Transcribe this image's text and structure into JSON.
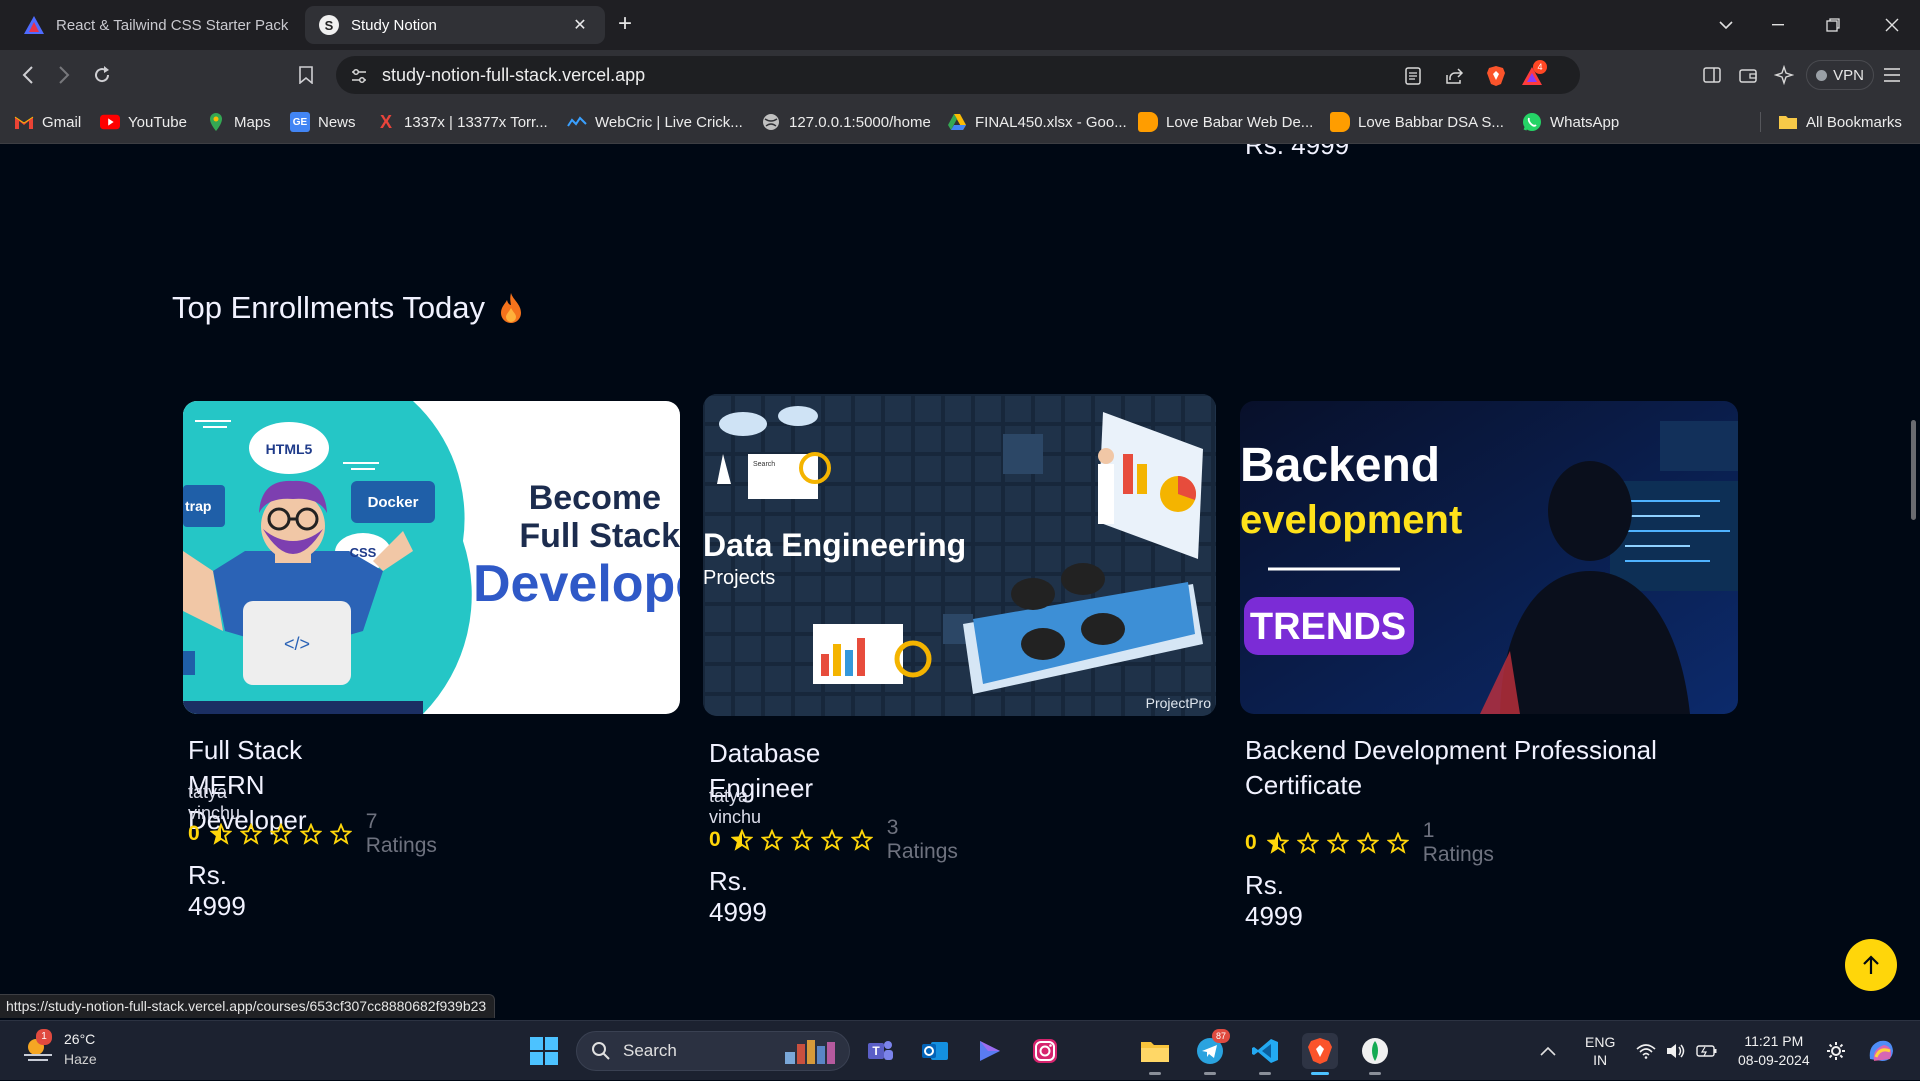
{
  "tabs": [
    {
      "title": "React & Tailwind CSS Starter Pack",
      "icon": "tailwind-triangle-icon"
    },
    {
      "title": "Study Notion",
      "icon": "study-notion-icon"
    }
  ],
  "address_bar": {
    "url": "study-notion-full-stack.vercel.app"
  },
  "toolbar": {
    "vpn_label": "VPN",
    "notif_count": "4"
  },
  "bookmarks": [
    {
      "label": "Gmail",
      "icon": "gmail-icon"
    },
    {
      "label": "YouTube",
      "icon": "youtube-icon"
    },
    {
      "label": "Maps",
      "icon": "maps-icon"
    },
    {
      "label": "News",
      "icon": "news-icon"
    },
    {
      "label": "1337x | 13377x Torr...",
      "icon": "x-icon"
    },
    {
      "label": "WebCric | Live Crick...",
      "icon": "webcric-icon"
    },
    {
      "label": "127.0.0.1:5000/home",
      "icon": "globe-icon"
    },
    {
      "label": "FINAL450.xlsx - Goo...",
      "icon": "drive-icon"
    },
    {
      "label": "Love Babar Web De...",
      "icon": "bookmark-orange-icon"
    },
    {
      "label": "Love Babbar DSA S...",
      "icon": "bookmark-orange-icon"
    },
    {
      "label": "WhatsApp",
      "icon": "whatsapp-icon"
    },
    {
      "label": "All Bookmarks",
      "icon": "folder-icon"
    }
  ],
  "page": {
    "prev_price_partial": "Rs. 4999",
    "section_title": "Top Enrollments Today",
    "courses": [
      {
        "title": "Full Stack MERN Developer",
        "author": "tatya vinchu",
        "rating": "0",
        "ratings_count": "7 Ratings",
        "price": "Rs. 4999",
        "thumb_text": {
          "line1": "Become",
          "line2": "Full Stack",
          "line3": "Develope",
          "bubble1": "HTML5",
          "bubble2": "Docker",
          "bubble3": "CSS",
          "tag": "trap",
          "code": "</>"
        }
      },
      {
        "title": "Database Engineer",
        "author": "tatya vinchu",
        "rating": "0",
        "ratings_count": "3 Ratings",
        "price": "Rs. 4999",
        "thumb_text": {
          "line1": "Data Engineering",
          "line2": "Projects",
          "brand": "ProjectPro",
          "search": "Search"
        }
      },
      {
        "title": "Backend Development Professional Certificate",
        "author": "",
        "rating": "0",
        "ratings_count": "1 Ratings",
        "price": "Rs. 4999",
        "thumb_text": {
          "line1": "Backend",
          "line2": "evelopment",
          "tag": "TRENDS"
        }
      }
    ],
    "accent_yellow": "#FFD60A"
  },
  "status_bar": {
    "hover_url": "https://study-notion-full-stack.vercel.app/courses/653cf307cc8880682f939b23"
  },
  "taskbar": {
    "weather_temp": "26°C",
    "weather_cond": "Haze",
    "weather_badge": "1",
    "search_label": "Search",
    "telegram_badge": "87",
    "lang_line1": "ENG",
    "lang_line2": "IN",
    "time": "11:21 PM",
    "date": "08-09-2024"
  }
}
